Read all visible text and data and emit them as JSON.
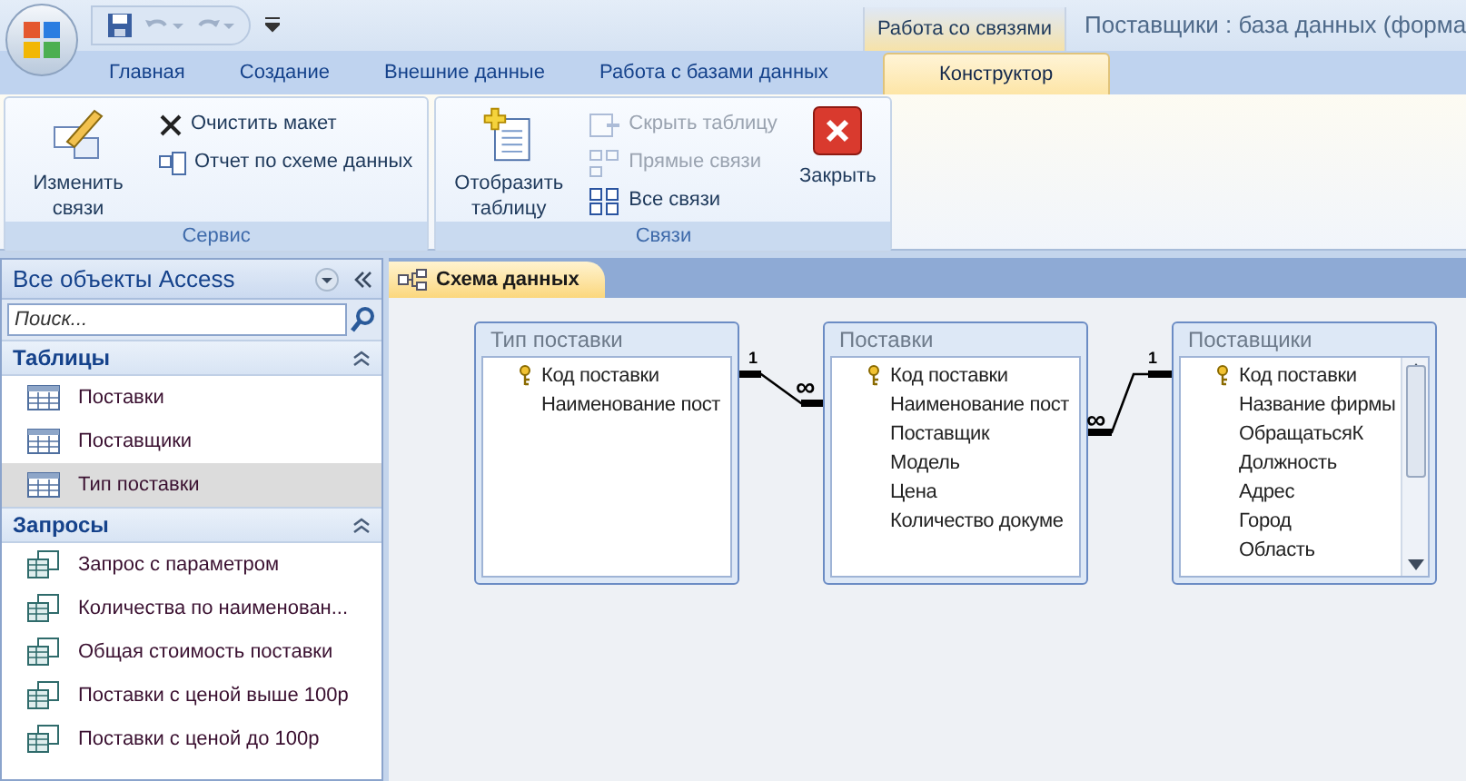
{
  "title_bar": {
    "contextual_tab": "Работа со связями",
    "title": "Поставщики : база данных (форма"
  },
  "tabs": [
    {
      "label": "Главная",
      "selected": false
    },
    {
      "label": "Создание",
      "selected": false
    },
    {
      "label": "Внешние данные",
      "selected": false
    },
    {
      "label": "Работа с базами данных",
      "selected": false
    },
    {
      "label": "Конструктор",
      "selected": true
    }
  ],
  "ribbon_groups": [
    {
      "label": "Сервис",
      "buttons": [
        {
          "kind": "large",
          "label": "Изменить связи",
          "disabled": false
        },
        {
          "kind": "small",
          "label": "Очистить макет",
          "disabled": false
        },
        {
          "kind": "small",
          "label": "Отчет по схеме данных",
          "disabled": false
        }
      ]
    },
    {
      "label": "Связи",
      "buttons": [
        {
          "kind": "large",
          "label": "Отобразить таблицу",
          "disabled": false
        },
        {
          "kind": "small",
          "label": "Скрыть таблицу",
          "disabled": true
        },
        {
          "kind": "small",
          "label": "Прямые связи",
          "disabled": true
        },
        {
          "kind": "small",
          "label": "Все связи",
          "disabled": false
        },
        {
          "kind": "large",
          "label": "Закрыть",
          "disabled": false
        }
      ]
    }
  ],
  "nav": {
    "title": "Все объекты Access",
    "search_placeholder": "Поиск...",
    "sections": [
      {
        "label": "Таблицы",
        "expanded": true,
        "kind": "table",
        "items": [
          {
            "label": "Поставки",
            "selected": false
          },
          {
            "label": "Поставщики",
            "selected": false
          },
          {
            "label": "Тип поставки",
            "selected": true
          }
        ]
      },
      {
        "label": "Запросы",
        "expanded": true,
        "kind": "query",
        "items": [
          {
            "label": "Запрос с параметром",
            "selected": false
          },
          {
            "label": "Количества по наименован...",
            "selected": false
          },
          {
            "label": "Общая стоимость поставки",
            "selected": false
          },
          {
            "label": "Поставки с ценой выше 100р",
            "selected": false
          },
          {
            "label": "Поставки с ценой до 100р",
            "selected": false
          }
        ]
      }
    ]
  },
  "document_tab": {
    "label": "Схема данных",
    "selected": true
  },
  "tables": [
    {
      "title": "Тип поставки",
      "scrollbar": false,
      "fields": [
        {
          "name": "Код поставки",
          "primary_key": true
        },
        {
          "name": "Наименование пост",
          "primary_key": false
        }
      ]
    },
    {
      "title": "Поставки",
      "scrollbar": false,
      "fields": [
        {
          "name": "Код поставки",
          "primary_key": true
        },
        {
          "name": "Наименование пост",
          "primary_key": false
        },
        {
          "name": "Поставщик",
          "primary_key": false
        },
        {
          "name": "Модель",
          "primary_key": false
        },
        {
          "name": "Цена",
          "primary_key": false
        },
        {
          "name": "Количество докуме",
          "primary_key": false
        }
      ]
    },
    {
      "title": "Поставщики",
      "scrollbar": true,
      "fields": [
        {
          "name": "Код поставки",
          "primary_key": true
        },
        {
          "name": "Название фирмы",
          "primary_key": false
        },
        {
          "name": "ОбращатьсяК",
          "primary_key": false
        },
        {
          "name": "Должность",
          "primary_key": false
        },
        {
          "name": "Адрес",
          "primary_key": false
        },
        {
          "name": "Город",
          "primary_key": false
        },
        {
          "name": "Область",
          "primary_key": false
        }
      ]
    }
  ],
  "relationships": [
    {
      "one_label": "1",
      "many_label": "∞"
    },
    {
      "one_label": "1",
      "many_label": "∞"
    }
  ]
}
